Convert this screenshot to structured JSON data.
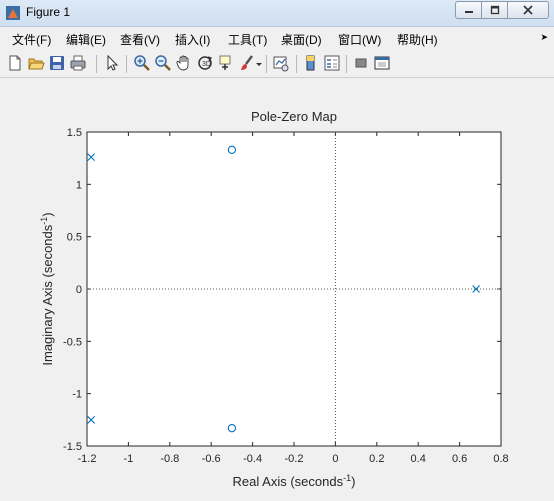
{
  "window": {
    "title": "Figure 1",
    "controls": [
      "minimize",
      "maximize",
      "close"
    ]
  },
  "menubar": {
    "items": [
      {
        "label": "文件(F)"
      },
      {
        "label": "编辑(E)"
      },
      {
        "label": "查看(V)"
      },
      {
        "label": "插入(I)"
      },
      {
        "label": "工具(T)"
      },
      {
        "label": "桌面(D)"
      },
      {
        "label": "窗口(W)"
      },
      {
        "label": "帮助(H)"
      }
    ],
    "overflow_icon": "chevron-right-icon"
  },
  "toolbar": {
    "buttons": [
      {
        "icon": "new-figure-icon"
      },
      {
        "icon": "open-file-icon"
      },
      {
        "icon": "save-icon"
      },
      {
        "icon": "print-icon"
      },
      {
        "icon": "edit-plot-icon"
      },
      {
        "icon": "zoom-in-icon"
      },
      {
        "icon": "zoom-out-icon"
      },
      {
        "icon": "pan-icon"
      },
      {
        "icon": "rotate-3d-icon"
      },
      {
        "icon": "data-cursor-icon"
      },
      {
        "icon": "brush-icon"
      },
      {
        "icon": "link-plot-icon"
      },
      {
        "icon": "colorbar-icon"
      },
      {
        "icon": "legend-icon"
      },
      {
        "icon": "hide-plot-tools-icon"
      },
      {
        "icon": "show-plot-tools-icon"
      }
    ]
  },
  "chart_data": {
    "type": "scatter",
    "title": "Pole-Zero Map",
    "xlabel": "Real Axis (seconds",
    "xlabel_sup": "-1",
    "xlabel_end": ")",
    "ylabel": "Imaginary Axis (seconds",
    "ylabel_sup": "-1",
    "ylabel_end": ")",
    "xlim": [
      -1.2,
      0.8
    ],
    "ylim": [
      -1.5,
      1.5
    ],
    "xticks": [
      -1.2,
      -1,
      -0.8,
      -0.6,
      -0.4,
      -0.2,
      0,
      0.2,
      0.4,
      0.6,
      0.8
    ],
    "xtick_labels": [
      "-1.2",
      "-1",
      "-0.8",
      "-0.6",
      "-0.4",
      "-0.2",
      "0",
      "0.2",
      "0.4",
      "0.6",
      "0.8"
    ],
    "yticks": [
      -1.5,
      -1,
      -0.5,
      0,
      0.5,
      1,
      1.5
    ],
    "ytick_labels": [
      "-1.5",
      "-1",
      "-0.5",
      "0",
      "0.5",
      "1",
      "1.5"
    ],
    "grid": false,
    "color": "#0072bd",
    "series": [
      {
        "marker": "x",
        "points": [
          {
            "x": -1.18,
            "y": 1.26
          },
          {
            "x": -1.18,
            "y": -1.25
          },
          {
            "x": 0.68,
            "y": 0
          }
        ]
      },
      {
        "marker": "o",
        "points": [
          {
            "x": -0.5,
            "y": 1.33
          },
          {
            "x": -0.5,
            "y": -1.33
          }
        ]
      }
    ]
  }
}
